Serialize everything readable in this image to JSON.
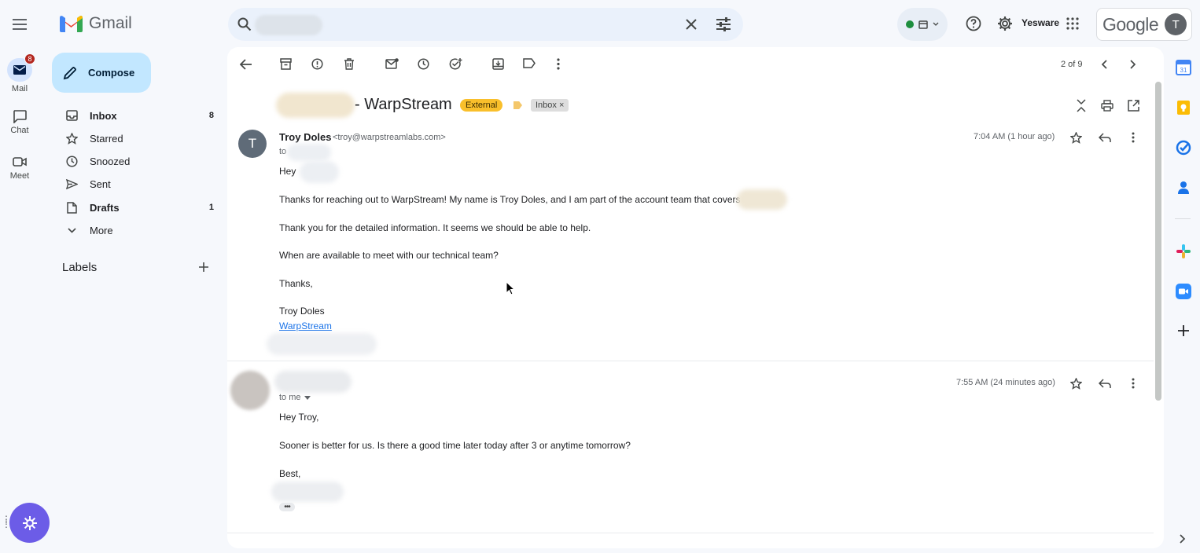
{
  "app": {
    "name": "Gmail"
  },
  "rail": {
    "mail_label": "Mail",
    "mail_badge": "8",
    "chat_label": "Chat",
    "meet_label": "Meet"
  },
  "sidebar": {
    "compose_label": "Compose",
    "items": [
      {
        "label": "Inbox",
        "count": "8",
        "icon": "inbox-icon",
        "bold": true
      },
      {
        "label": "Starred",
        "count": "",
        "icon": "star-icon"
      },
      {
        "label": "Snoozed",
        "count": "",
        "icon": "clock-icon"
      },
      {
        "label": "Sent",
        "count": "",
        "icon": "send-icon"
      },
      {
        "label": "Drafts",
        "count": "1",
        "icon": "draft-icon",
        "bold": true
      },
      {
        "label": "More",
        "count": "",
        "icon": "chevron-down-icon"
      }
    ],
    "labels_title": "Labels"
  },
  "topbar": {
    "yesware": "Yesware",
    "google": "Google",
    "avatar_initial": "T",
    "status_color": "#1e8e3e"
  },
  "toolbar": {
    "pager": "2 of 9"
  },
  "thread": {
    "subject": "- WarpStream",
    "tag_external": "External",
    "tag_inbox": "Inbox",
    "tag_inbox_close": "×",
    "messages": [
      {
        "avatar_initial": "T",
        "sender": "Troy Doles",
        "email": "<troy@warpstreamlabs.com>",
        "to": "to",
        "time": "7:04 AM (1 hour ago)",
        "greeting": "Hey",
        "lines": [
          "Thanks for reaching out to WarpStream! My name is Troy Doles, and I am part of the account team that covers",
          "Thank you for the detailed information. It seems we should be able to help.",
          "When are available to meet with our technical team?",
          "Thanks,",
          "Troy Doles"
        ],
        "link": "WarpStream"
      },
      {
        "to": "to me",
        "time": "7:55 AM (24 minutes ago)",
        "greeting": "Hey Troy,",
        "lines": [
          "Sooner is better for us. Is there a good time later today after 3 or anytime tomorrow?",
          "Best,"
        ],
        "ellipsis": "•••"
      }
    ]
  },
  "colors": {
    "accent": "#c2e7ff",
    "external_tag": "#f9bf2b",
    "link": "#1a73e8",
    "fab": "#6c5ce7"
  }
}
